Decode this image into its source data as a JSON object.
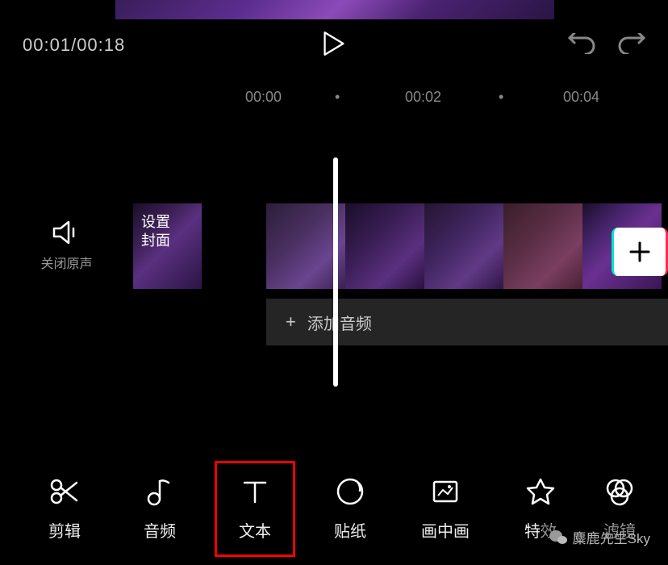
{
  "playback": {
    "current_time": "00:01",
    "total_time": "00:18",
    "separator": "/"
  },
  "ruler": {
    "ticks": [
      "00:00",
      "00:02",
      "00:04"
    ]
  },
  "mute": {
    "label": "关闭原声"
  },
  "cover": {
    "label_line1": "设置",
    "label_line2": "封面"
  },
  "audio": {
    "add_label": "添加音频",
    "plus": "+"
  },
  "toolbar": {
    "items": [
      {
        "label": "剪辑",
        "icon": "scissors"
      },
      {
        "label": "音频",
        "icon": "music-note"
      },
      {
        "label": "文本",
        "icon": "text"
      },
      {
        "label": "贴纸",
        "icon": "sticker"
      },
      {
        "label": "画中画",
        "icon": "picture-in-picture"
      },
      {
        "label": "特效",
        "icon": "star"
      },
      {
        "label": "滤镜",
        "icon": "filter"
      }
    ],
    "highlighted_index": 2
  },
  "watermark": {
    "text": "麋鹿先生Sky"
  }
}
